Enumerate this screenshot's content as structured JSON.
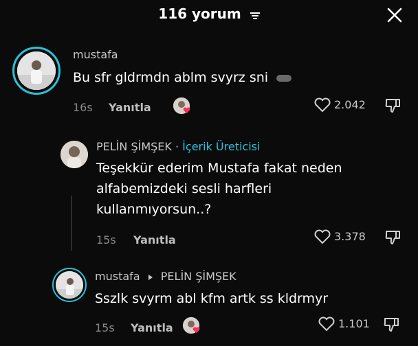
{
  "header": {
    "title": "116 yorum"
  },
  "comments": [
    {
      "user": "mustafa",
      "text": "Bu sfr gldrmdn ablm svyrz sni",
      "time": "16s",
      "reply": "Yanıtla",
      "likes": "2.042"
    },
    {
      "user": "PELİN ŞİMŞEK",
      "separator": "·",
      "badge": "İçerik Üreticisi",
      "text_lines": [
        "Teşekkür ederim Mustafa fakat neden",
        "alfabemizdeki sesli harfleri",
        "kullanmıyorsun..?"
      ],
      "time": "15s",
      "reply": "Yanıtla",
      "likes": "3.378"
    },
    {
      "user": "mustafa",
      "reply_to": "PELİN ŞİMŞEK",
      "text": "Sszlk svyrm abl kfm artk ss kldrmyr",
      "time": "15s",
      "reply": "Yanıtla",
      "likes": "1.101"
    }
  ],
  "colors": {
    "accent": "#29c3d9",
    "heart": "#ff2d55",
    "background": "#0b0b0c"
  },
  "icons": [
    "filter-icon",
    "close-icon",
    "heart-outline-icon",
    "dislike-icon",
    "creator-liked-icon",
    "reply-arrow-icon"
  ]
}
